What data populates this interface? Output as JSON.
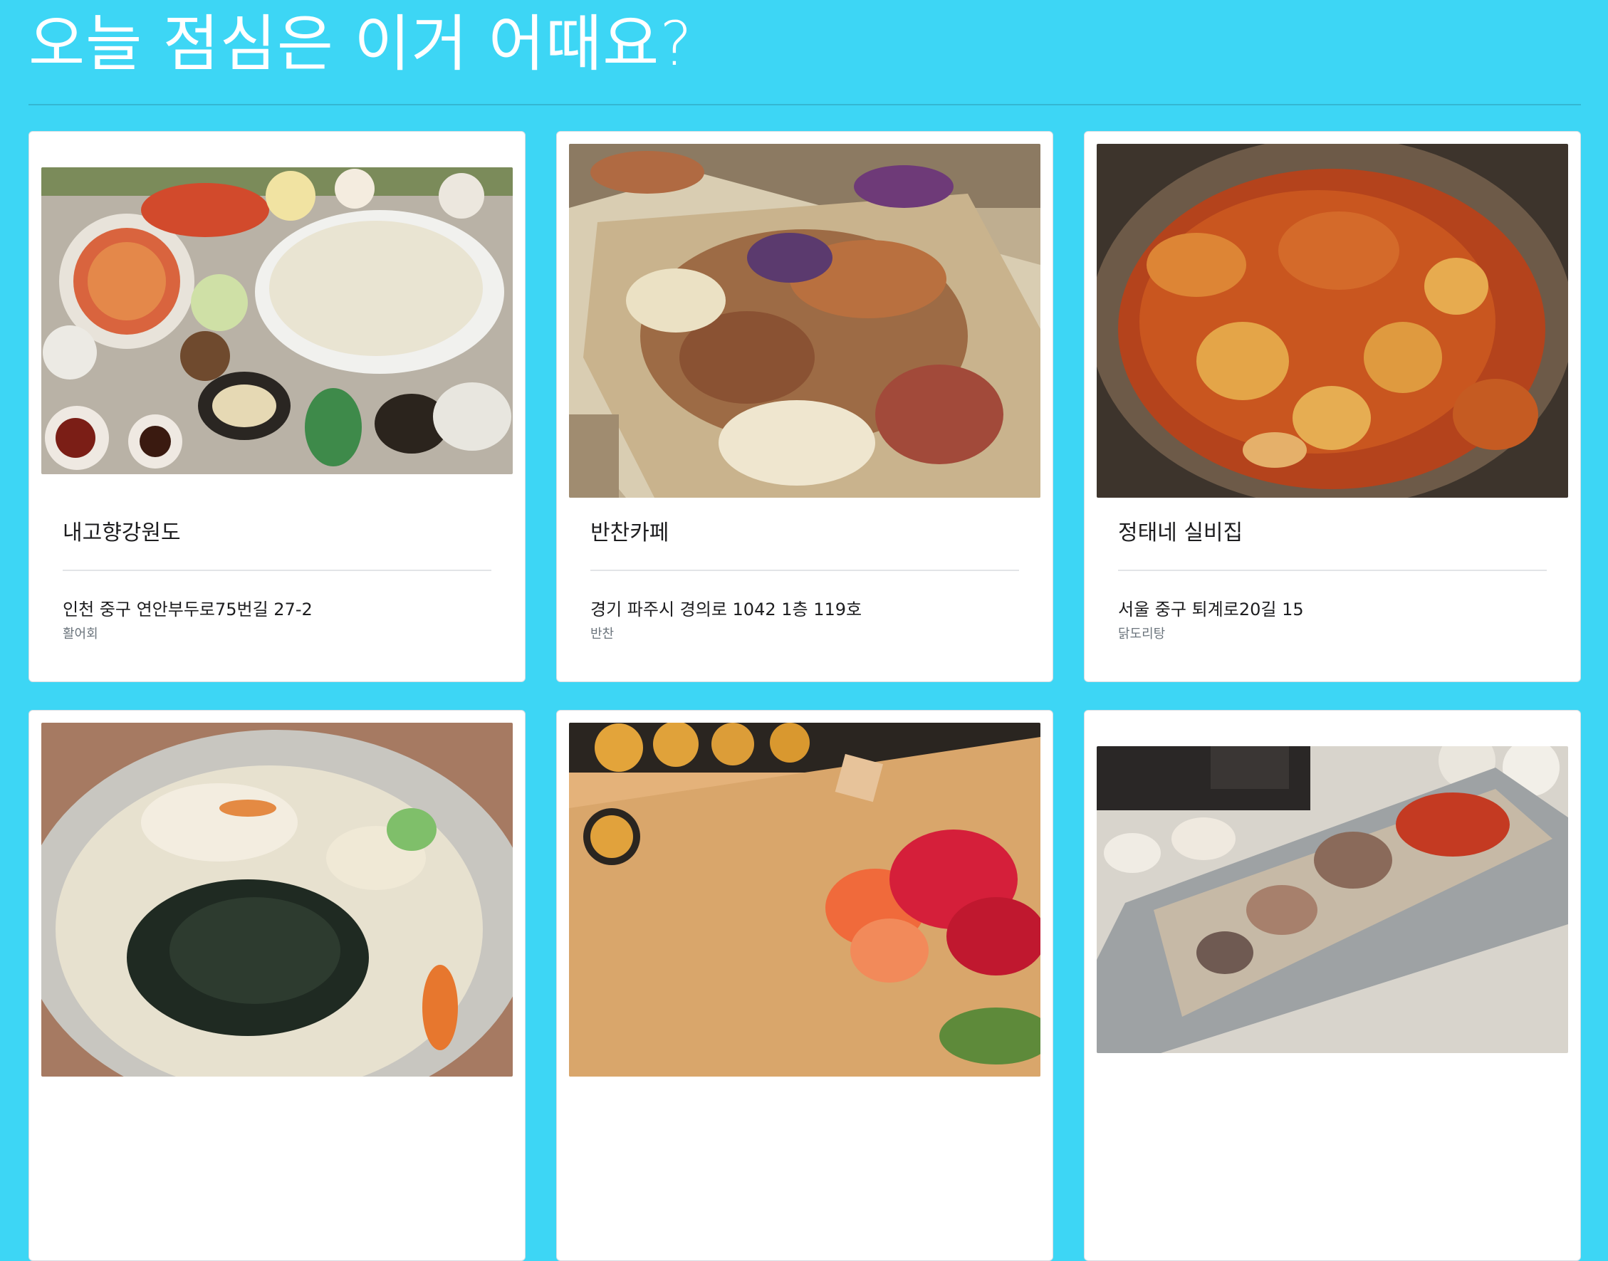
{
  "page": {
    "title": "오늘 점심은 이거 어때요?"
  },
  "colors": {
    "background": "#3dd6f5",
    "card": "#ffffff",
    "title_text": "#ffffff"
  },
  "restaurants": [
    {
      "name": "내고향강원도",
      "address": "인천 중구 연안부두로75번길 27-2",
      "category": "활어회",
      "photo_icon": "seafood-feast-photo"
    },
    {
      "name": "반찬카페",
      "address": "경기 파주시 경의로 1042 1층 119호",
      "category": "반찬",
      "photo_icon": "side-dish-photo"
    },
    {
      "name": "정태네 실비집",
      "address": "서울 중구 퇴계로20길 15",
      "category": "닭도리탕",
      "photo_icon": "braised-chicken-photo"
    },
    {
      "name": "",
      "address": "",
      "category": "",
      "photo_icon": "noodle-soup-photo"
    },
    {
      "name": "",
      "address": "",
      "category": "",
      "photo_icon": "sushi-roll-photo"
    },
    {
      "name": "",
      "address": "",
      "category": "",
      "photo_icon": "seafood-platter-photo"
    }
  ]
}
